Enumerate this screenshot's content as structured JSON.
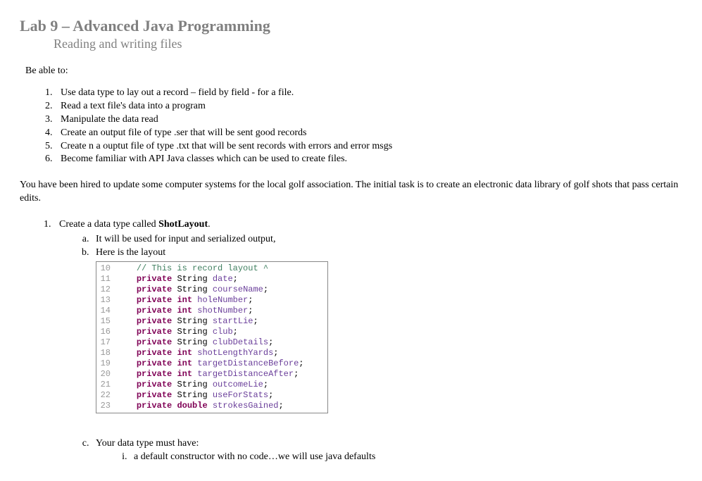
{
  "title_prefix": "Lab 9 – ",
  "title_main": "Advanced Java Programming",
  "subtitle": "Reading and writing files",
  "be_able_to": "Be able to:",
  "objectives": [
    "Use  data type to lay out a record – field by field - for a file.",
    "Read a text file's data into a program",
    "Manipulate the data read",
    "Create an output file of type .ser that will be sent good records",
    "Create n a ouptut file of type .txt that will be sent records with errors and error msgs",
    "Become familiar with API Java classes which can be used to create files."
  ],
  "intro_para": "You have been hired to update some computer systems for the local golf association. The initial task is to create an electronic data library of golf shots that pass certain edits.",
  "step1_prefix": "Create a data type called ",
  "step1_bold": "ShotLayout",
  "step1_suffix": ".",
  "step1a": "It will be used for input and  serialized output,",
  "step1b": "Here is the layout",
  "step1c": "Your data type must have:",
  "step1c_i": "a default constructor with no code…we will use java defaults",
  "code": [
    {
      "n": "10",
      "indent": "    ",
      "tokens": [
        {
          "t": "// This is record layout ^",
          "c": "cm"
        }
      ]
    },
    {
      "n": "11",
      "indent": "    ",
      "tokens": [
        {
          "t": "private",
          "c": "kw"
        },
        {
          "t": " "
        },
        {
          "t": "String",
          "c": "typ"
        },
        {
          "t": " "
        },
        {
          "t": "date",
          "c": "ident"
        },
        {
          "t": ";"
        }
      ]
    },
    {
      "n": "12",
      "indent": "    ",
      "tokens": [
        {
          "t": "private",
          "c": "kw"
        },
        {
          "t": " "
        },
        {
          "t": "String",
          "c": "typ"
        },
        {
          "t": " "
        },
        {
          "t": "courseName",
          "c": "ident"
        },
        {
          "t": ";"
        }
      ]
    },
    {
      "n": "13",
      "indent": "    ",
      "tokens": [
        {
          "t": "private",
          "c": "kw"
        },
        {
          "t": " "
        },
        {
          "t": "int",
          "c": "kw"
        },
        {
          "t": " "
        },
        {
          "t": "holeNumber",
          "c": "ident"
        },
        {
          "t": ";"
        }
      ]
    },
    {
      "n": "14",
      "indent": "    ",
      "tokens": [
        {
          "t": "private",
          "c": "kw"
        },
        {
          "t": " "
        },
        {
          "t": "int",
          "c": "kw"
        },
        {
          "t": " "
        },
        {
          "t": "shotNumber",
          "c": "ident"
        },
        {
          "t": ";"
        }
      ]
    },
    {
      "n": "15",
      "indent": "    ",
      "tokens": [
        {
          "t": "private",
          "c": "kw"
        },
        {
          "t": " "
        },
        {
          "t": "String",
          "c": "typ"
        },
        {
          "t": " "
        },
        {
          "t": "startLie",
          "c": "ident"
        },
        {
          "t": ";"
        }
      ]
    },
    {
      "n": "16",
      "indent": "    ",
      "tokens": [
        {
          "t": "private",
          "c": "kw"
        },
        {
          "t": " "
        },
        {
          "t": "String",
          "c": "typ"
        },
        {
          "t": " "
        },
        {
          "t": "club",
          "c": "ident"
        },
        {
          "t": ";"
        }
      ]
    },
    {
      "n": "17",
      "indent": "    ",
      "tokens": [
        {
          "t": "private",
          "c": "kw"
        },
        {
          "t": " "
        },
        {
          "t": "String",
          "c": "typ"
        },
        {
          "t": " "
        },
        {
          "t": "clubDetails",
          "c": "ident"
        },
        {
          "t": ";"
        }
      ]
    },
    {
      "n": "18",
      "indent": "    ",
      "tokens": [
        {
          "t": "private",
          "c": "kw"
        },
        {
          "t": " "
        },
        {
          "t": "int",
          "c": "kw"
        },
        {
          "t": " "
        },
        {
          "t": "shotLengthYards",
          "c": "ident"
        },
        {
          "t": ";"
        }
      ]
    },
    {
      "n": "19",
      "indent": "    ",
      "tokens": [
        {
          "t": "private",
          "c": "kw"
        },
        {
          "t": " "
        },
        {
          "t": "int",
          "c": "kw"
        },
        {
          "t": " "
        },
        {
          "t": "targetDistanceBefore",
          "c": "ident"
        },
        {
          "t": ";"
        }
      ]
    },
    {
      "n": "20",
      "indent": "    ",
      "tokens": [
        {
          "t": "private",
          "c": "kw"
        },
        {
          "t": " "
        },
        {
          "t": "int",
          "c": "kw"
        },
        {
          "t": " "
        },
        {
          "t": "targetDistanceAfter",
          "c": "ident"
        },
        {
          "t": ";"
        }
      ]
    },
    {
      "n": "21",
      "indent": "    ",
      "tokens": [
        {
          "t": "private",
          "c": "kw"
        },
        {
          "t": " "
        },
        {
          "t": "String",
          "c": "typ"
        },
        {
          "t": " "
        },
        {
          "t": "outcomeLie",
          "c": "ident"
        },
        {
          "t": ";"
        }
      ]
    },
    {
      "n": "22",
      "indent": "    ",
      "tokens": [
        {
          "t": "private",
          "c": "kw"
        },
        {
          "t": " "
        },
        {
          "t": "String",
          "c": "typ"
        },
        {
          "t": " "
        },
        {
          "t": "useForStats",
          "c": "ident"
        },
        {
          "t": ";"
        }
      ]
    },
    {
      "n": "23",
      "indent": "    ",
      "tokens": [
        {
          "t": "private",
          "c": "kw"
        },
        {
          "t": " "
        },
        {
          "t": "double",
          "c": "kw"
        },
        {
          "t": " "
        },
        {
          "t": "strokesGained",
          "c": "ident"
        },
        {
          "t": ";"
        }
      ]
    }
  ]
}
